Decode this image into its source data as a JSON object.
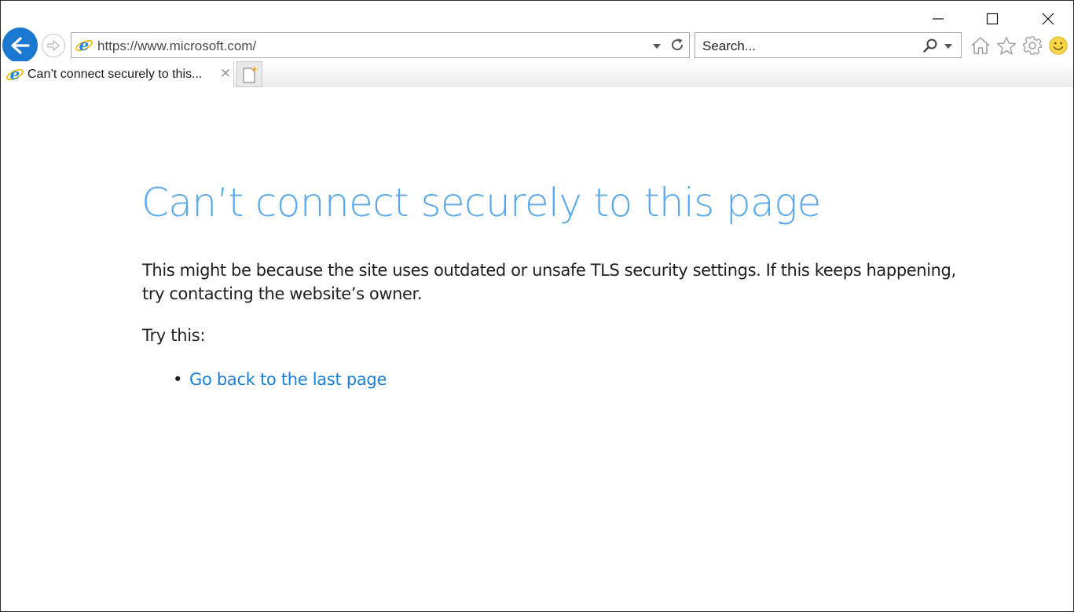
{
  "window": {
    "minimize_label": "minimize",
    "maximize_label": "maximize",
    "close_label": "close"
  },
  "navbar": {
    "address_url": "https://www.microsoft.com/",
    "search_placeholder": "Search..."
  },
  "tabs": [
    {
      "title": "Can’t connect securely to this...",
      "close_glyph": "×",
      "active": true
    }
  ],
  "page": {
    "heading": "Can’t connect securely to this page",
    "description": "This might be because the site uses outdated or unsafe TLS security settings. If this keeps happening, try contacting the website’s owner.",
    "try_this_label": "Try this:",
    "bullet_glyph": "•",
    "suggestions": [
      {
        "label": "Go back to the last page"
      }
    ]
  },
  "icons": {
    "back": "back-arrow-icon",
    "forward": "forward-arrow-icon",
    "site": "internet-explorer-icon",
    "refresh": "refresh-icon",
    "search": "magnifier-icon",
    "home": "home-icon",
    "favorites": "star-icon",
    "tools": "gear-icon",
    "feedback": "smiley-icon",
    "new_tab": "new-tab-icon"
  },
  "colors": {
    "accent": "#1b78d0",
    "heading": "#5ba9e8",
    "link": "#1a7fd3",
    "text": "#1f1f1f"
  }
}
